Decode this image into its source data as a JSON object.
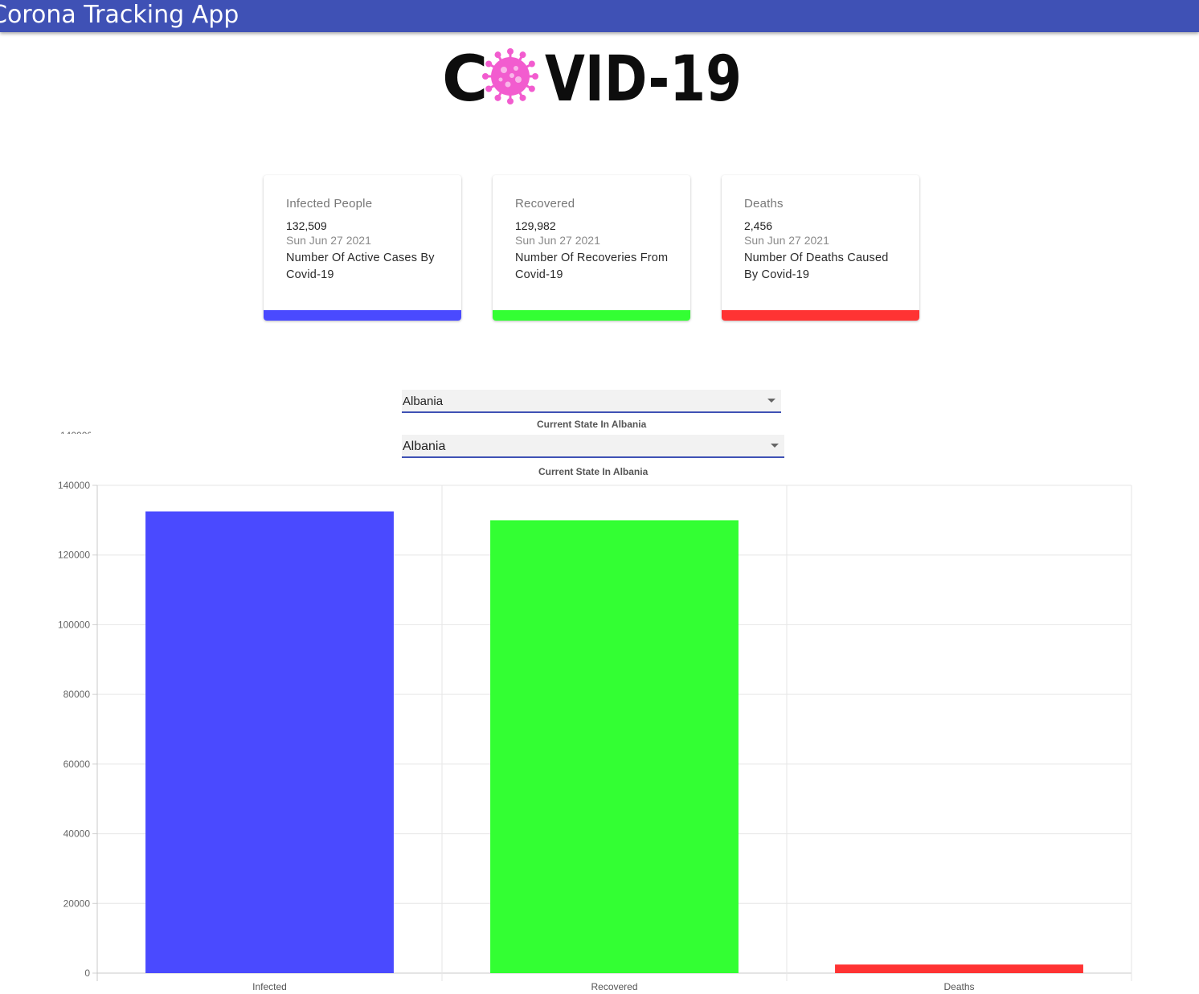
{
  "appbar": {
    "title": "Corona Tracking App"
  },
  "logo": {
    "text_left": "C",
    "text_right": "VID-19",
    "virus_color": "#f25ccf"
  },
  "cards": [
    {
      "title": "Infected People",
      "value": "132,509",
      "date": "Sun Jun 27 2021",
      "description": "Number Of Active Cases By Covid-19",
      "color": "#4a4aff"
    },
    {
      "title": "Recovered",
      "value": "129,982",
      "date": "Sun Jun 27 2021",
      "description": "Number Of Recoveries From Covid-19",
      "color": "#33ff33"
    },
    {
      "title": "Deaths",
      "value": "2,456",
      "date": "Sun Jun 27 2021",
      "description": "Number Of Deaths Caused By Covid-19",
      "color": "#ff3333"
    }
  ],
  "selectors": [
    {
      "value": "Albania",
      "caption": "Current State In Albania"
    },
    {
      "value": "Albania",
      "caption": "Current State In Albania"
    }
  ],
  "ghost_tick": "140000",
  "chart_data": {
    "type": "bar",
    "categories": [
      "Infected",
      "Recovered",
      "Deaths"
    ],
    "values": [
      132509,
      129982,
      2456
    ],
    "colors": [
      "#4a4aff",
      "#33ff33",
      "#ff3333"
    ],
    "yticks": [
      0,
      20000,
      40000,
      60000,
      80000,
      100000,
      120000,
      140000
    ],
    "ylim": [
      0,
      140000
    ],
    "grid": true
  }
}
